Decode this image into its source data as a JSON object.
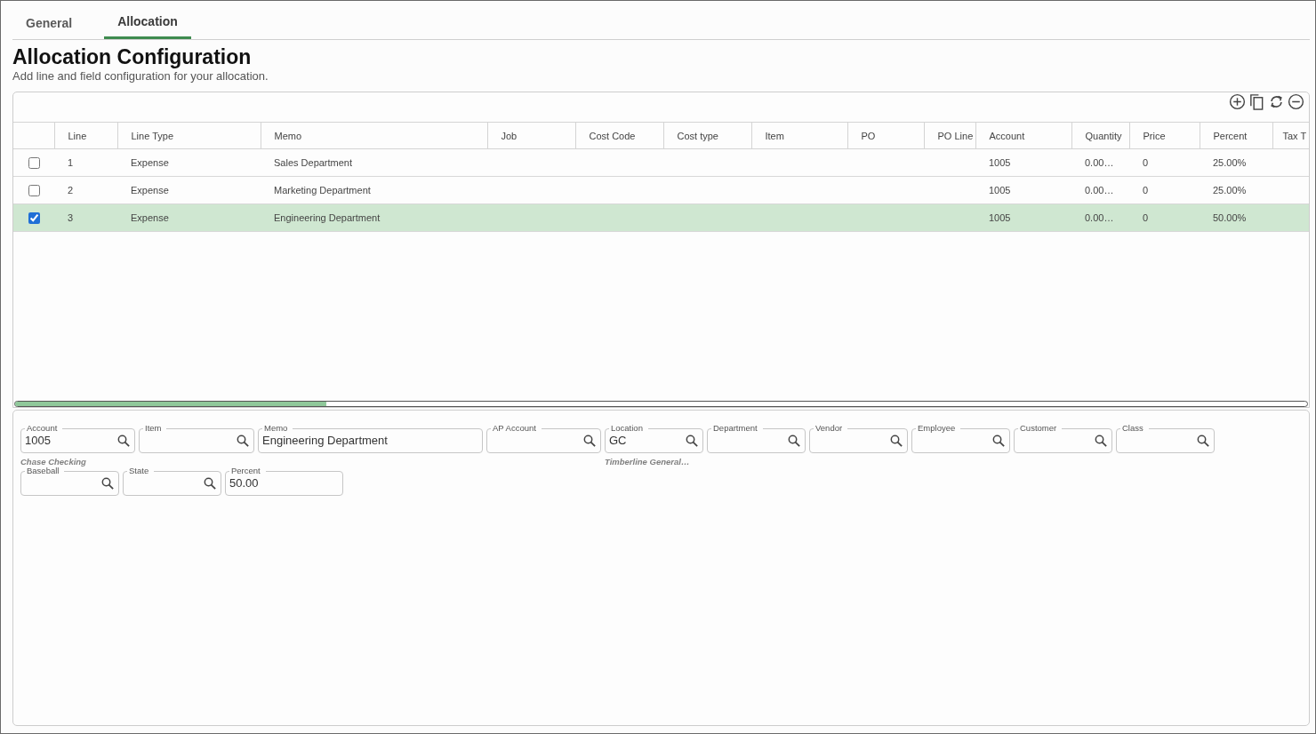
{
  "tabs": [
    {
      "label": "General",
      "selected": false
    },
    {
      "label": "Allocation",
      "selected": true
    }
  ],
  "header": {
    "title": "Allocation Configuration",
    "subtitle": "Add line and field configuration for your allocation."
  },
  "grid": {
    "columns": [
      "Line",
      "Line Type",
      "Memo",
      "Job",
      "Cost Code",
      "Cost type",
      "Item",
      "PO",
      "PO Line",
      "Account",
      "Quantity",
      "Price",
      "Percent",
      "Tax T"
    ],
    "rows": [
      {
        "checked": false,
        "selected": false,
        "line": "1",
        "line_type": "Expense",
        "memo": "Sales Department",
        "account": "1005",
        "quantity": "0.00…",
        "price": "0",
        "percent": "25.00%"
      },
      {
        "checked": false,
        "selected": false,
        "line": "2",
        "line_type": "Expense",
        "memo": "Marketing Department",
        "account": "1005",
        "quantity": "0.00…",
        "price": "0",
        "percent": "25.00%"
      },
      {
        "checked": true,
        "selected": true,
        "line": "3",
        "line_type": "Expense",
        "memo": "Engineering Department",
        "account": "1005",
        "quantity": "0.00…",
        "price": "0",
        "percent": "50.00%"
      }
    ]
  },
  "detail": {
    "rows": [
      {
        "fields": [
          {
            "kind": "lookup",
            "label": "Account",
            "value": "1005",
            "helper": "Chase Checking"
          },
          {
            "kind": "lookup",
            "label": "Item"
          },
          {
            "kind": "text",
            "label": "Memo",
            "value": "Engineering Department"
          },
          {
            "kind": "lookup",
            "label": "AP Account"
          },
          {
            "kind": "lookup",
            "label": "Location",
            "value": "GC",
            "helper": "Timberline General…"
          },
          {
            "kind": "lookup",
            "label": "Department"
          },
          {
            "kind": "lookup",
            "label": "Vendor"
          },
          {
            "kind": "lookup",
            "label": "Employee"
          },
          {
            "kind": "lookup",
            "label": "Customer"
          },
          {
            "kind": "lookup",
            "label": "Class"
          }
        ]
      },
      {
        "fields": [
          {
            "kind": "lookup",
            "label": "Baseball"
          },
          {
            "kind": "lookup",
            "label": "State"
          },
          {
            "kind": "text",
            "label": "Percent",
            "value": "50.00"
          }
        ]
      }
    ]
  }
}
